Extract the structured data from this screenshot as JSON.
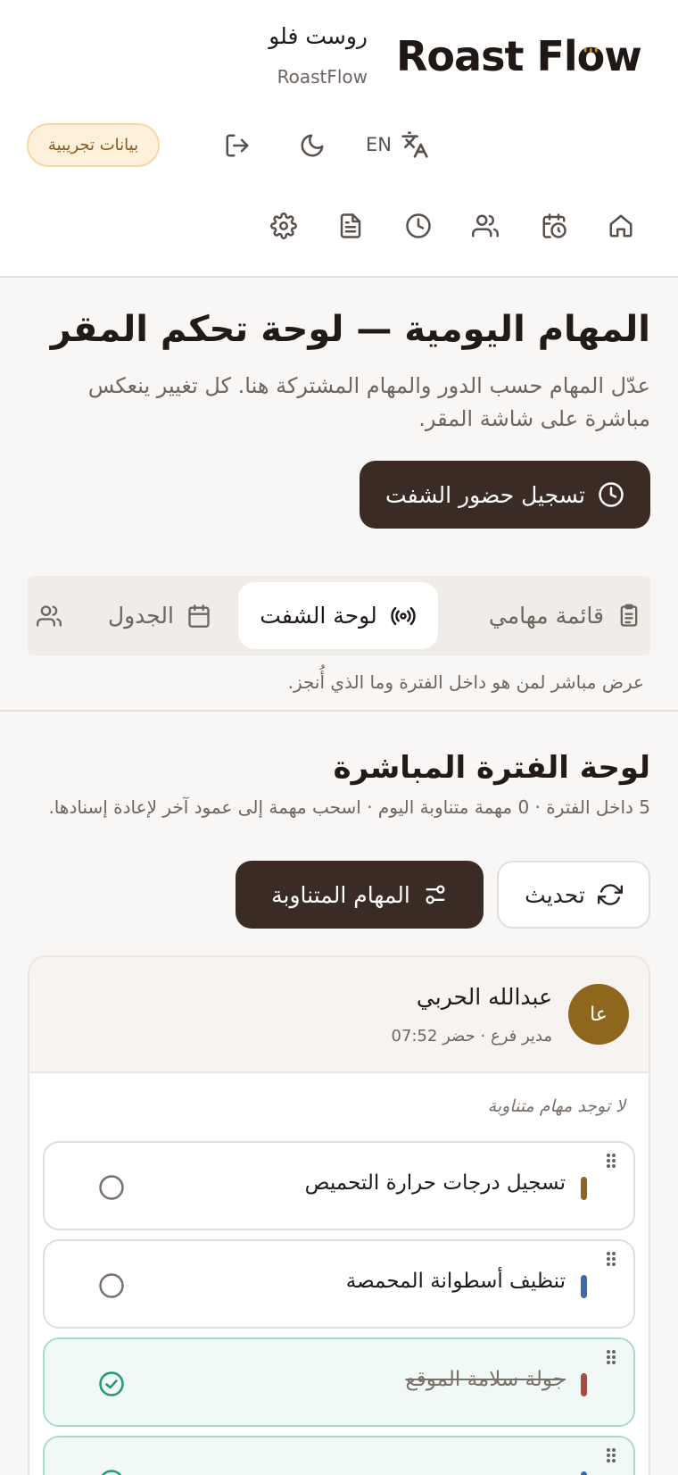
{
  "header": {
    "logo_text": "Roast Flow",
    "brand_name_ar": "روست فلو",
    "brand_name_en": "RoastFlow",
    "demo_badge": "بيانات تجريبية",
    "language_code": "EN"
  },
  "nav_icons": [
    "home-icon",
    "calendar-clock-icon",
    "users-icon",
    "clock-icon",
    "document-icon",
    "gear-icon"
  ],
  "page": {
    "title": "المهام اليومية — لوحة تحكم المقر",
    "description": "عدّل المهام حسب الدور والمهام المشتركة هنا. كل تغيير ينعكس مباشرة على شاشة المقر.",
    "clock_in_button": "تسجيل حضور الشفت"
  },
  "tabs": [
    {
      "label": "قائمة مهامي",
      "icon": "clipboard-icon",
      "active": false
    },
    {
      "label": "لوحة الشفت",
      "icon": "broadcast-icon",
      "active": true
    },
    {
      "label": "الجدول",
      "icon": "calendar-icon",
      "active": false
    },
    {
      "label": "",
      "icon": "users-icon",
      "active": false
    }
  ],
  "tab_hint": "عرض مباشر لمن هو داخل الفترة وما الذي أُنجز.",
  "board": {
    "title": "لوحة الفترة المباشرة",
    "meta": "5 داخل الفترة · 0 مهمة متناوبة اليوم · اسحب مهمة إلى عمود آخر لإعادة إسنادها.",
    "rotating_tasks_button": "المهام المتناوبة",
    "refresh_button": "تحديث"
  },
  "employee": {
    "initials": "عا",
    "name": "عبدالله الحربي",
    "role_status": "مدير فرع · حضر 07:52",
    "empty_rotating_note": "لا توجد مهام متناوبة",
    "tasks": [
      {
        "label": "تسجيل درجات حرارة التحميص",
        "color": "#8e661e",
        "done": false
      },
      {
        "label": "تنظيف أسطوانة المحمصة",
        "color": "#3a6aa8",
        "done": false
      },
      {
        "label": "جولة سلامة الموقع",
        "color": "#b04a3a",
        "done": true
      },
      {
        "label": "",
        "color": "#3a6aa8",
        "done": true
      }
    ]
  },
  "colors": {
    "primary_dark": "#3a2c25",
    "badge_bg": "#fdf1dc",
    "avatar": "#8e661e",
    "done_green": "#1f9a6e"
  }
}
